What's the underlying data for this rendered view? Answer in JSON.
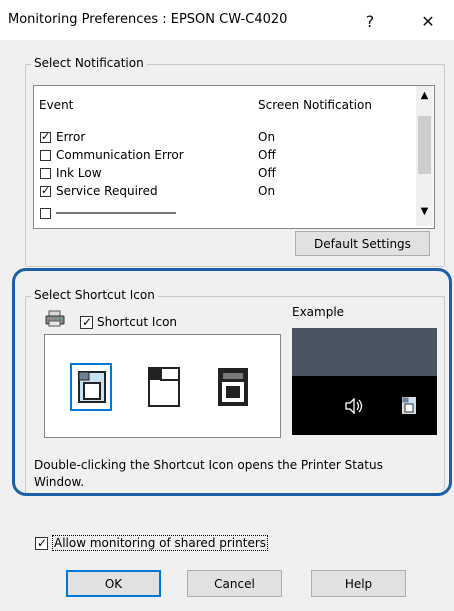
{
  "window": {
    "title": "Monitoring Preferences : EPSON CW-C4020",
    "help_glyph": "?",
    "close_glyph": "✕"
  },
  "notification": {
    "group_label": "Select Notification",
    "col_event": "Event",
    "col_screen": "Screen Notification",
    "rows": [
      {
        "event": "Error",
        "value": "On",
        "checked": true
      },
      {
        "event": "Communication Error",
        "value": "Off",
        "checked": false
      },
      {
        "event": "Ink Low",
        "value": "Off",
        "checked": false
      },
      {
        "event": "Service Required",
        "value": "On",
        "checked": true
      }
    ],
    "default_button": "Default Settings"
  },
  "shortcut": {
    "group_label": "Select Shortcut Icon",
    "checkbox_label": "Shortcut Icon",
    "checked": true,
    "example_label": "Example",
    "description": "Double-clicking the Shortcut Icon opens the Printer Status Window.",
    "icons": [
      "printer-shortcut-icon-1",
      "printer-shortcut-icon-2",
      "printer-shortcut-icon-3"
    ],
    "selected_index": 0
  },
  "shared": {
    "label": "Allow monitoring of shared printers",
    "checked": true
  },
  "buttons": {
    "ok": "OK",
    "cancel": "Cancel",
    "help": "Help"
  },
  "colors": {
    "highlight": "#1a5fa8",
    "selection": "#0078d7",
    "taskbar": "#000000",
    "desktop": "#4a5360"
  }
}
